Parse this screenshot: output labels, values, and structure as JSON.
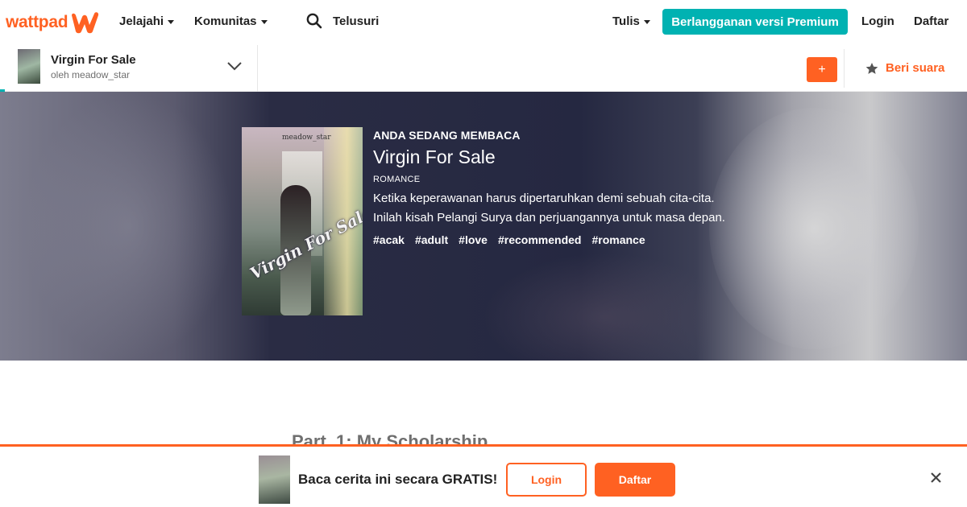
{
  "nav": {
    "logo": "wattpad",
    "explore": "Jelajahi",
    "community": "Komunitas",
    "search_label": "Telusuri",
    "write": "Tulis",
    "premium": "Berlangganan versi Premium",
    "login": "Login",
    "register": "Daftar"
  },
  "story_bar": {
    "title": "Virgin For Sale",
    "author": "oleh meadow_star",
    "add_button": "+",
    "vote_label": "Beri suara"
  },
  "hero": {
    "reading_label": "ANDA SEDANG MEMBACA",
    "title": "Virgin For Sale",
    "genre": "ROMANCE",
    "description": "Ketika keperawanan harus dipertaruhkan demi sebuah cita-cita. Inilah kisah Pelangi Surya dan perjuangannya untuk masa depan.",
    "tags": [
      "#acak",
      "#adult",
      "#love",
      "#recommended",
      "#romance"
    ],
    "cover_author": "meadow_star",
    "cover_title": "Virgin For Sale"
  },
  "content": {
    "part_title": "Part. 1: My Scholarship"
  },
  "banner": {
    "text": "Baca cerita ini secara GRATIS!",
    "login": "Login",
    "register": "Daftar"
  },
  "colors": {
    "brand_orange": "#ff6122",
    "teal": "#00b2b2"
  }
}
